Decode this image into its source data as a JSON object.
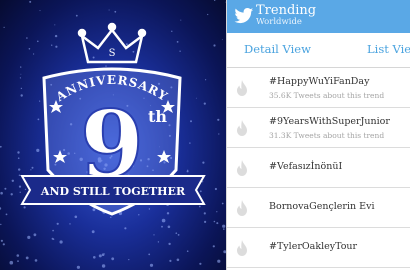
{
  "banner": {
    "anniversary_text": "ANNIVERSARY",
    "number": "9",
    "suffix": "th",
    "ribbon_text": "AND STILL TOGETHER",
    "crown_letter": "S"
  },
  "header": {
    "title": "Trending",
    "subtitle": "Worldwide",
    "icon": "twitter-bird-icon",
    "color": "#5aa8e6"
  },
  "tabs": [
    {
      "label": "Detail View"
    },
    {
      "label": "List View"
    }
  ],
  "trends": [
    {
      "name": "#HappyWuYiFanDay",
      "subtitle": "35.6K Tweets about this trend"
    },
    {
      "name": "#9YearsWithSuperJunior",
      "subtitle": "31.3K Tweets about this trend"
    },
    {
      "name": "#VefasızİnönüI",
      "subtitle": ""
    },
    {
      "name": "BornovaGençlerin Evi",
      "subtitle": ""
    },
    {
      "name": "#TylerOakleyTour",
      "subtitle": ""
    }
  ],
  "colors": {
    "accent": "#4aa3df",
    "flame": "#dcdcdc"
  }
}
